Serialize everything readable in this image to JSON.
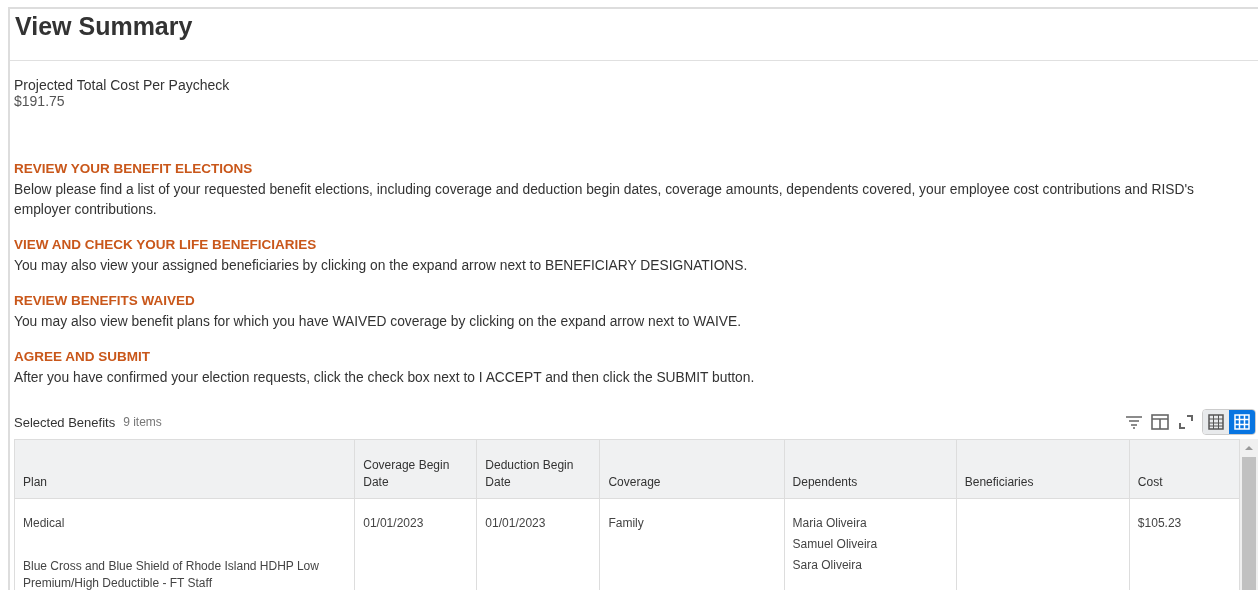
{
  "title": "View Summary",
  "projected": {
    "label": "Projected Total Cost Per Paycheck",
    "value": "$191.75"
  },
  "sections": [
    {
      "heading": "REVIEW YOUR BENEFIT ELECTIONS",
      "text": "Below please find a list of your requested benefit elections, including coverage and deduction begin dates, coverage amounts, dependents covered, your employee cost contributions and RISD's employer contributions."
    },
    {
      "heading": "VIEW AND CHECK YOUR LIFE BENEFICIARIES",
      "text": "You may also view your assigned beneficiaries by clicking on the expand arrow next to BENEFICIARY DESIGNATIONS."
    },
    {
      "heading": "REVIEW BENEFITS WAIVED",
      "text": "You may also view benefit plans for which you have WAIVED coverage by clicking on the expand arrow next to WAIVE."
    },
    {
      "heading": "AGREE AND SUBMIT",
      "text": "After you have confirmed your election requests, click the check box next to I ACCEPT and then click the SUBMIT button."
    }
  ],
  "table": {
    "title": "Selected Benefits",
    "count": "9 items",
    "view_toggles": [
      {
        "kind": "table",
        "selected": false
      },
      {
        "kind": "grid",
        "selected": true
      }
    ],
    "columns": [
      "Plan",
      "Coverage Begin Date",
      "Deduction Begin Date",
      "Coverage",
      "Dependents",
      "Beneficiaries",
      "Cost"
    ],
    "rows": [
      {
        "plan": "Medical",
        "plan_detail": "Blue Cross and Blue Shield of Rhode Island HDHP Low Premium/High Deductible - FT Staff",
        "coverage_begin": "01/01/2023",
        "deduction_begin": "01/01/2023",
        "coverage": "Family",
        "dependents": [
          "Maria Oliveira",
          "Samuel Oliveira",
          "Sara Oliveira"
        ],
        "cost": "$105.23"
      }
    ]
  }
}
